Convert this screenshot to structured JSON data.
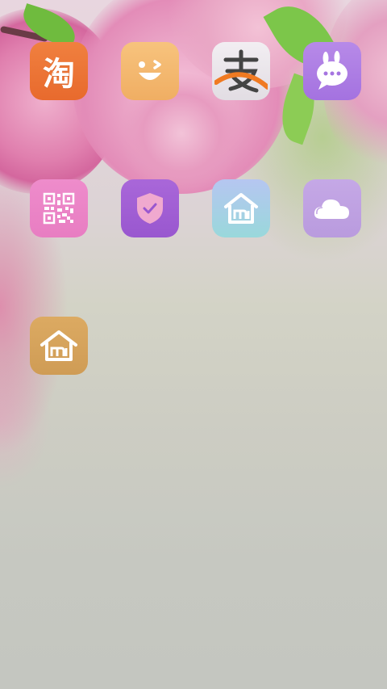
{
  "screen": {
    "name": "launcher-home-screen"
  },
  "apps": {
    "row1": [
      {
        "icon": "taobao-icon",
        "glyph": "淘",
        "color": "#e8742f"
      },
      {
        "icon": "smiley-icon",
        "color": "#f3b66e"
      },
      {
        "icon": "alipay-icon",
        "color": "#e8e4e9"
      },
      {
        "icon": "chat-bubble-bunny-icon",
        "color": "#ab7ae3"
      }
    ],
    "row2": [
      {
        "icon": "qr-code-icon",
        "color": "#eb85c6"
      },
      {
        "icon": "security-shield-icon",
        "color": "#a05fd4"
      },
      {
        "icon": "mi-home-icon",
        "color": "#a8cfe6"
      },
      {
        "icon": "cloud-icon",
        "color": "#bfa2e2"
      }
    ],
    "row3": [
      {
        "icon": "home-icon",
        "color": "#d6a35b"
      }
    ]
  }
}
